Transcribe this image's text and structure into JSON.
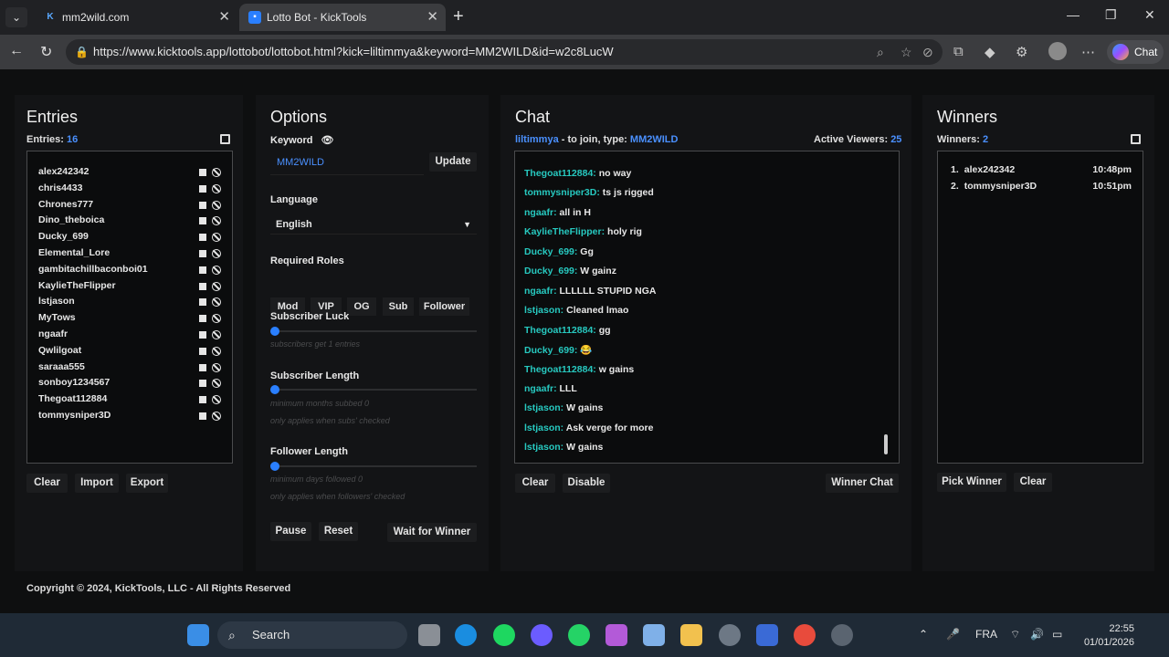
{
  "browser": {
    "tabs": [
      {
        "title": "mm2wild.com",
        "active": false
      },
      {
        "title": "Lotto Bot - KickTools",
        "active": true
      }
    ],
    "url": "https://www.kicktools.app/lottobot/lottobot.html?kick=liltimmya&keyword=MM2WILD&id=w2c8LucW",
    "chat_label": "Chat"
  },
  "entries": {
    "title": "Entries",
    "count_label": "Entries:",
    "count": "16",
    "items": [
      "alex242342",
      "chris4433",
      "Chrones777",
      "Dino_theboica",
      "Ducky_699",
      "Elemental_Lore",
      "gambitachillbaconboi01",
      "KaylieTheFlipper",
      "lstjason",
      "MyTows",
      "ngaafr",
      "Qwlilgoat",
      "saraaa555",
      "sonboy1234567",
      "Thegoat112884",
      "tommysniper3D"
    ],
    "buttons": {
      "clear": "Clear",
      "import": "Import",
      "export": "Export"
    }
  },
  "options": {
    "title": "Options",
    "keyword_label": "Keyword",
    "keyword_value": "MM2WILD",
    "update": "Update",
    "language_label": "Language",
    "language_value": "English",
    "roles_label": "Required Roles",
    "roles": [
      "Mod",
      "VIP",
      "OG",
      "Sub",
      "Follower"
    ],
    "sub_luck_label": "Subscriber Luck",
    "sub_luck_hint": "subscribers get 1 entries",
    "sub_length_label": "Subscriber Length",
    "sub_length_hint1": "minimum months subbed 0",
    "sub_length_hint2": "only applies when subs' checked",
    "follower_length_label": "Follower Length",
    "follower_length_hint1": "minimum days followed 0",
    "follower_length_hint2": "only applies when followers' checked",
    "buttons": {
      "pause": "Pause",
      "reset": "Reset",
      "wait": "Wait for Winner"
    }
  },
  "chat": {
    "title": "Chat",
    "channel": "liltimmya",
    "join_text": " - to join, type: ",
    "keyword": "MM2WILD",
    "viewers_label": "Active Viewers:",
    "viewers": "25",
    "messages": [
      {
        "user": "Thegoat112884:",
        "text": "no way"
      },
      {
        "user": "tommysniper3D:",
        "text": "ts js rigged"
      },
      {
        "user": "ngaafr:",
        "text": "all in H"
      },
      {
        "user": "KaylieTheFlipper:",
        "text": "holy rig"
      },
      {
        "user": "Ducky_699:",
        "text": "Gg"
      },
      {
        "user": "Ducky_699:",
        "text": "W gainz"
      },
      {
        "user": "ngaafr:",
        "text": "LLLLLL STUPID NGA"
      },
      {
        "user": "lstjason:",
        "text": "Cleaned lmao"
      },
      {
        "user": "Thegoat112884:",
        "text": "gg"
      },
      {
        "user": "Ducky_699:",
        "text": "😂"
      },
      {
        "user": "Thegoat112884:",
        "text": "w gains"
      },
      {
        "user": "ngaafr:",
        "text": "LLL"
      },
      {
        "user": "lstjason:",
        "text": "W gains"
      },
      {
        "user": "lstjason:",
        "text": "Ask verge for more"
      },
      {
        "user": "lstjason:",
        "text": "W gains"
      }
    ],
    "buttons": {
      "clear": "Clear",
      "disable": "Disable",
      "winner_chat": "Winner Chat"
    }
  },
  "winners": {
    "title": "Winners",
    "count_label": "Winners:",
    "count": "2",
    "items": [
      {
        "rank": "1.",
        "name": "alex242342",
        "time": "10:48pm"
      },
      {
        "rank": "2.",
        "name": "tommysniper3D",
        "time": "10:51pm"
      }
    ],
    "buttons": {
      "pick": "Pick Winner",
      "clear": "Clear"
    }
  },
  "footer": "Copyright © 2024, KickTools, LLC - All Rights Reserved",
  "taskbar": {
    "search": "Search",
    "lang": "FRA",
    "time": "22:55",
    "date": "01/01/2026"
  }
}
